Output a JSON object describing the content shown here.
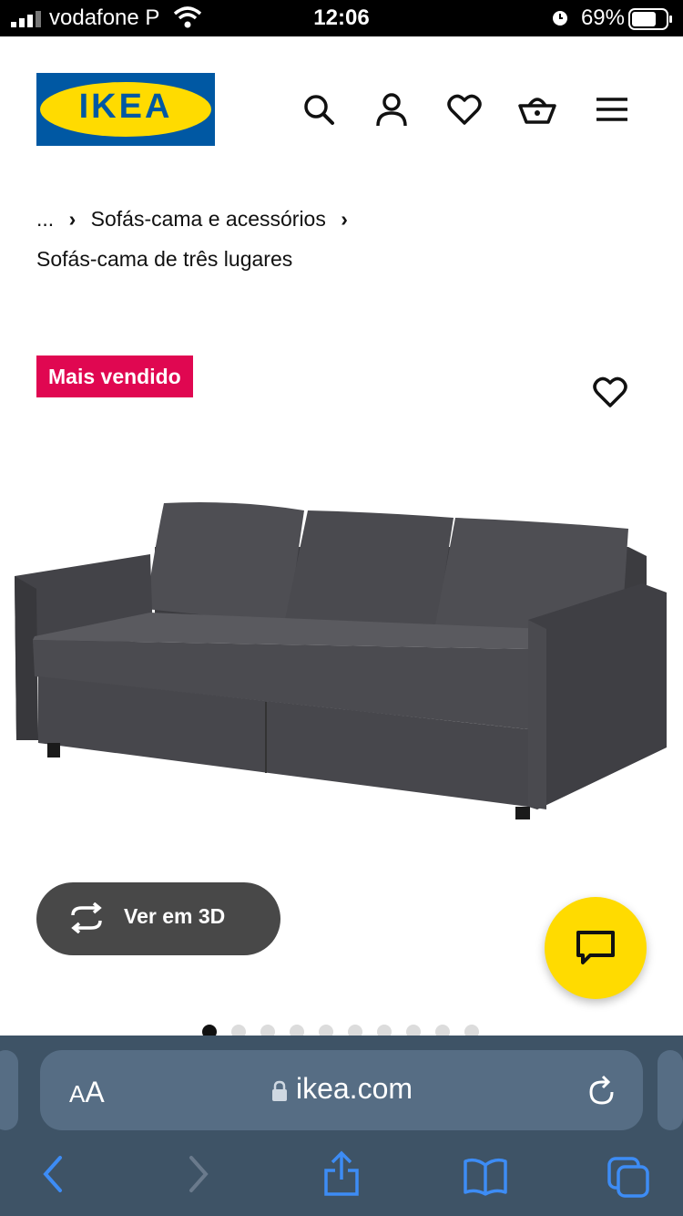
{
  "status_bar": {
    "carrier": "vodafone P",
    "time": "12:06",
    "battery": "69%"
  },
  "header": {
    "logo_text": "IKEA",
    "icons": [
      "search-icon",
      "user-icon",
      "heart-icon",
      "basket-icon",
      "menu-icon"
    ]
  },
  "breadcrumb": {
    "ellipsis": "...",
    "parent": "Sofás-cama e acessórios",
    "current": "Sofás-cama de três lugares"
  },
  "product": {
    "badge": "Mais vendido",
    "view_3d_label": "Ver em 3D"
  },
  "carousel": {
    "total": 10,
    "active_index": 0
  },
  "browser": {
    "aa_label": "AA",
    "url": "ikea.com"
  },
  "colors": {
    "brand_blue": "#0058a3",
    "brand_yellow": "#ffdb00",
    "badge_red": "#e00751"
  }
}
